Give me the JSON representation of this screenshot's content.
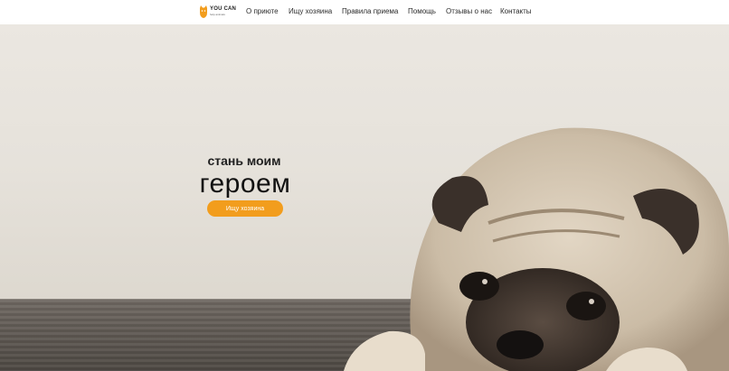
{
  "logo": {
    "brand": "YOU CAN",
    "tagline": "help animals"
  },
  "nav": {
    "items": [
      "О приюте",
      "Ищу хозяина",
      "Правила приема",
      "Помощь",
      "Отзывы о нас",
      "Контакты"
    ]
  },
  "hero": {
    "subtitle": "стань моим",
    "title": "героем",
    "cta_label": "Ищу хозяина"
  },
  "colors": {
    "accent": "#f29d1d",
    "wall": "#e6e2db",
    "floor": "#5e5852"
  },
  "icons": {
    "logo": "cat-icon"
  }
}
